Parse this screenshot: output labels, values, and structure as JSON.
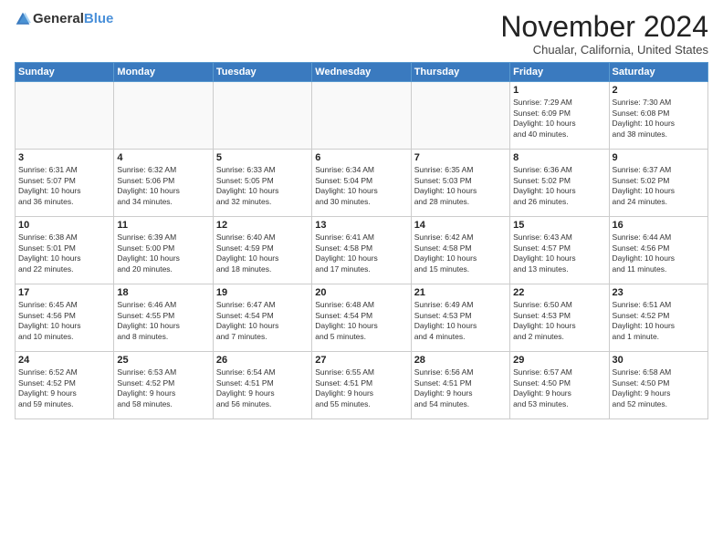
{
  "header": {
    "logo_general": "General",
    "logo_blue": "Blue",
    "title": "November 2024",
    "location": "Chualar, California, United States"
  },
  "calendar": {
    "days_of_week": [
      "Sunday",
      "Monday",
      "Tuesday",
      "Wednesday",
      "Thursday",
      "Friday",
      "Saturday"
    ],
    "weeks": [
      [
        {
          "day": "",
          "info": ""
        },
        {
          "day": "",
          "info": ""
        },
        {
          "day": "",
          "info": ""
        },
        {
          "day": "",
          "info": ""
        },
        {
          "day": "",
          "info": ""
        },
        {
          "day": "1",
          "info": "Sunrise: 7:29 AM\nSunset: 6:09 PM\nDaylight: 10 hours\nand 40 minutes."
        },
        {
          "day": "2",
          "info": "Sunrise: 7:30 AM\nSunset: 6:08 PM\nDaylight: 10 hours\nand 38 minutes."
        }
      ],
      [
        {
          "day": "3",
          "info": "Sunrise: 6:31 AM\nSunset: 5:07 PM\nDaylight: 10 hours\nand 36 minutes."
        },
        {
          "day": "4",
          "info": "Sunrise: 6:32 AM\nSunset: 5:06 PM\nDaylight: 10 hours\nand 34 minutes."
        },
        {
          "day": "5",
          "info": "Sunrise: 6:33 AM\nSunset: 5:05 PM\nDaylight: 10 hours\nand 32 minutes."
        },
        {
          "day": "6",
          "info": "Sunrise: 6:34 AM\nSunset: 5:04 PM\nDaylight: 10 hours\nand 30 minutes."
        },
        {
          "day": "7",
          "info": "Sunrise: 6:35 AM\nSunset: 5:03 PM\nDaylight: 10 hours\nand 28 minutes."
        },
        {
          "day": "8",
          "info": "Sunrise: 6:36 AM\nSunset: 5:02 PM\nDaylight: 10 hours\nand 26 minutes."
        },
        {
          "day": "9",
          "info": "Sunrise: 6:37 AM\nSunset: 5:02 PM\nDaylight: 10 hours\nand 24 minutes."
        }
      ],
      [
        {
          "day": "10",
          "info": "Sunrise: 6:38 AM\nSunset: 5:01 PM\nDaylight: 10 hours\nand 22 minutes."
        },
        {
          "day": "11",
          "info": "Sunrise: 6:39 AM\nSunset: 5:00 PM\nDaylight: 10 hours\nand 20 minutes."
        },
        {
          "day": "12",
          "info": "Sunrise: 6:40 AM\nSunset: 4:59 PM\nDaylight: 10 hours\nand 18 minutes."
        },
        {
          "day": "13",
          "info": "Sunrise: 6:41 AM\nSunset: 4:58 PM\nDaylight: 10 hours\nand 17 minutes."
        },
        {
          "day": "14",
          "info": "Sunrise: 6:42 AM\nSunset: 4:58 PM\nDaylight: 10 hours\nand 15 minutes."
        },
        {
          "day": "15",
          "info": "Sunrise: 6:43 AM\nSunset: 4:57 PM\nDaylight: 10 hours\nand 13 minutes."
        },
        {
          "day": "16",
          "info": "Sunrise: 6:44 AM\nSunset: 4:56 PM\nDaylight: 10 hours\nand 11 minutes."
        }
      ],
      [
        {
          "day": "17",
          "info": "Sunrise: 6:45 AM\nSunset: 4:56 PM\nDaylight: 10 hours\nand 10 minutes."
        },
        {
          "day": "18",
          "info": "Sunrise: 6:46 AM\nSunset: 4:55 PM\nDaylight: 10 hours\nand 8 minutes."
        },
        {
          "day": "19",
          "info": "Sunrise: 6:47 AM\nSunset: 4:54 PM\nDaylight: 10 hours\nand 7 minutes."
        },
        {
          "day": "20",
          "info": "Sunrise: 6:48 AM\nSunset: 4:54 PM\nDaylight: 10 hours\nand 5 minutes."
        },
        {
          "day": "21",
          "info": "Sunrise: 6:49 AM\nSunset: 4:53 PM\nDaylight: 10 hours\nand 4 minutes."
        },
        {
          "day": "22",
          "info": "Sunrise: 6:50 AM\nSunset: 4:53 PM\nDaylight: 10 hours\nand 2 minutes."
        },
        {
          "day": "23",
          "info": "Sunrise: 6:51 AM\nSunset: 4:52 PM\nDaylight: 10 hours\nand 1 minute."
        }
      ],
      [
        {
          "day": "24",
          "info": "Sunrise: 6:52 AM\nSunset: 4:52 PM\nDaylight: 9 hours\nand 59 minutes."
        },
        {
          "day": "25",
          "info": "Sunrise: 6:53 AM\nSunset: 4:52 PM\nDaylight: 9 hours\nand 58 minutes."
        },
        {
          "day": "26",
          "info": "Sunrise: 6:54 AM\nSunset: 4:51 PM\nDaylight: 9 hours\nand 56 minutes."
        },
        {
          "day": "27",
          "info": "Sunrise: 6:55 AM\nSunset: 4:51 PM\nDaylight: 9 hours\nand 55 minutes."
        },
        {
          "day": "28",
          "info": "Sunrise: 6:56 AM\nSunset: 4:51 PM\nDaylight: 9 hours\nand 54 minutes."
        },
        {
          "day": "29",
          "info": "Sunrise: 6:57 AM\nSunset: 4:50 PM\nDaylight: 9 hours\nand 53 minutes."
        },
        {
          "day": "30",
          "info": "Sunrise: 6:58 AM\nSunset: 4:50 PM\nDaylight: 9 hours\nand 52 minutes."
        }
      ]
    ]
  }
}
